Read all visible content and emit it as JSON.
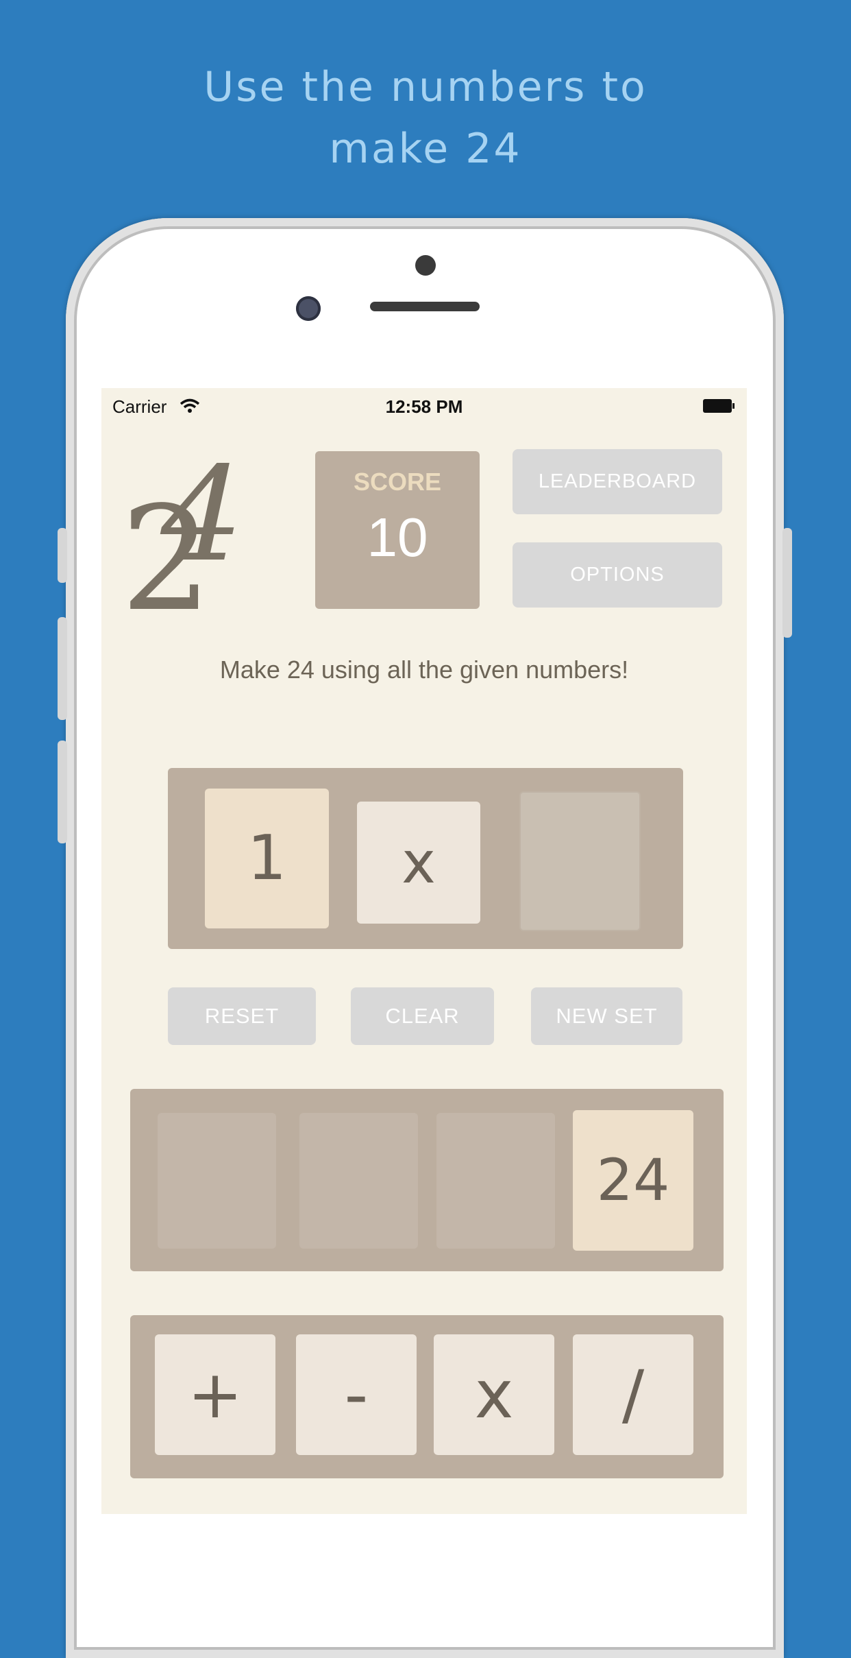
{
  "headline": {
    "line1": "Use the numbers to",
    "line2": "make 24"
  },
  "status_bar": {
    "carrier": "Carrier",
    "time": "12:58 PM"
  },
  "logo": {
    "text1": "2",
    "text2": "4"
  },
  "score": {
    "label": "SCORE",
    "value": "10"
  },
  "buttons": {
    "leaderboard": "LEADERBOARD",
    "options": "OPTIONS",
    "reset": "RESET",
    "clear": "CLEAR",
    "new_set": "NEW SET"
  },
  "instruction": "Make 24 using all the given numbers!",
  "expression": {
    "slot1": "1",
    "slot2": "x",
    "slot3": ""
  },
  "numbers": {
    "n1": "",
    "n2": "",
    "n3": "",
    "n4": "24"
  },
  "operators": {
    "plus": "+",
    "minus": "-",
    "times": "x",
    "divide": "/"
  },
  "colors": {
    "background": "#2d7dbe",
    "screen": "#f6f2e6",
    "panel": "#bcae9f",
    "tile": "#eee0cb",
    "button": "#d8d8d8"
  }
}
